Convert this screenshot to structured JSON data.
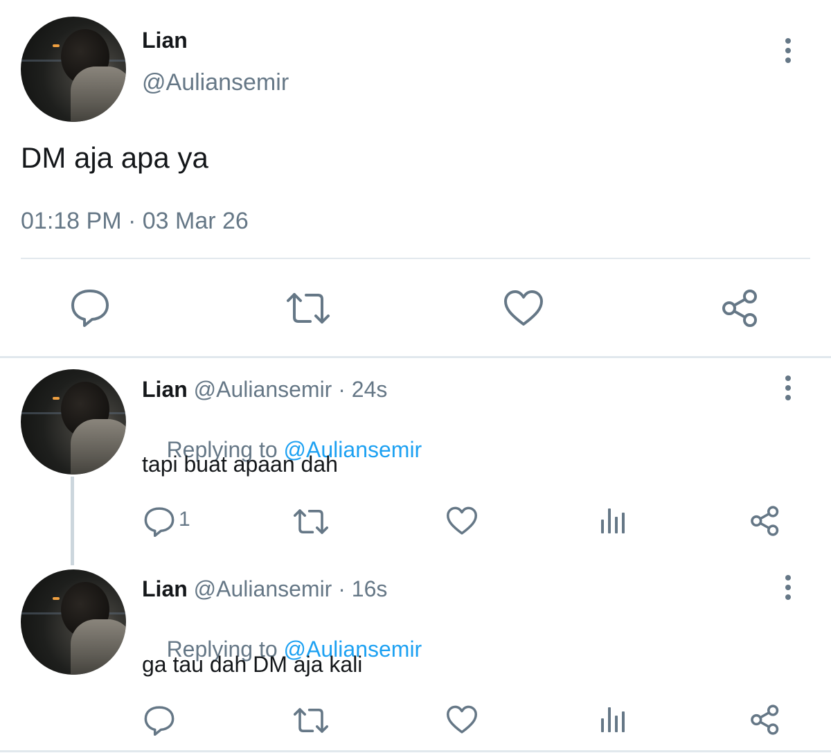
{
  "main_tweet": {
    "author_name": "Lian",
    "author_handle": "@Auliansemir",
    "text": "DM aja apa ya",
    "timestamp": "01:18 PM · 03 Mar 26",
    "actions": [
      "reply-icon",
      "retweet-icon",
      "like-icon",
      "share-icon"
    ]
  },
  "replies": [
    {
      "author_name": "Lian",
      "author_handle": "@Auliansemir",
      "time": " · 24s",
      "replying_prefix": "Replying to ",
      "replying_handle": "@Auliansemir",
      "text": "tapi buat apaan dah",
      "reply_count": "1"
    },
    {
      "author_name": "Lian",
      "author_handle": "@Auliansemir",
      "time": " · 16s",
      "replying_prefix": "Replying to ",
      "replying_handle": "@Auliansemir",
      "text": "ga tau dah DM aja kali",
      "reply_count": ""
    }
  ],
  "colors": {
    "icon": "#657786",
    "link": "#1da1f2",
    "divider": "#e1e8ed"
  }
}
